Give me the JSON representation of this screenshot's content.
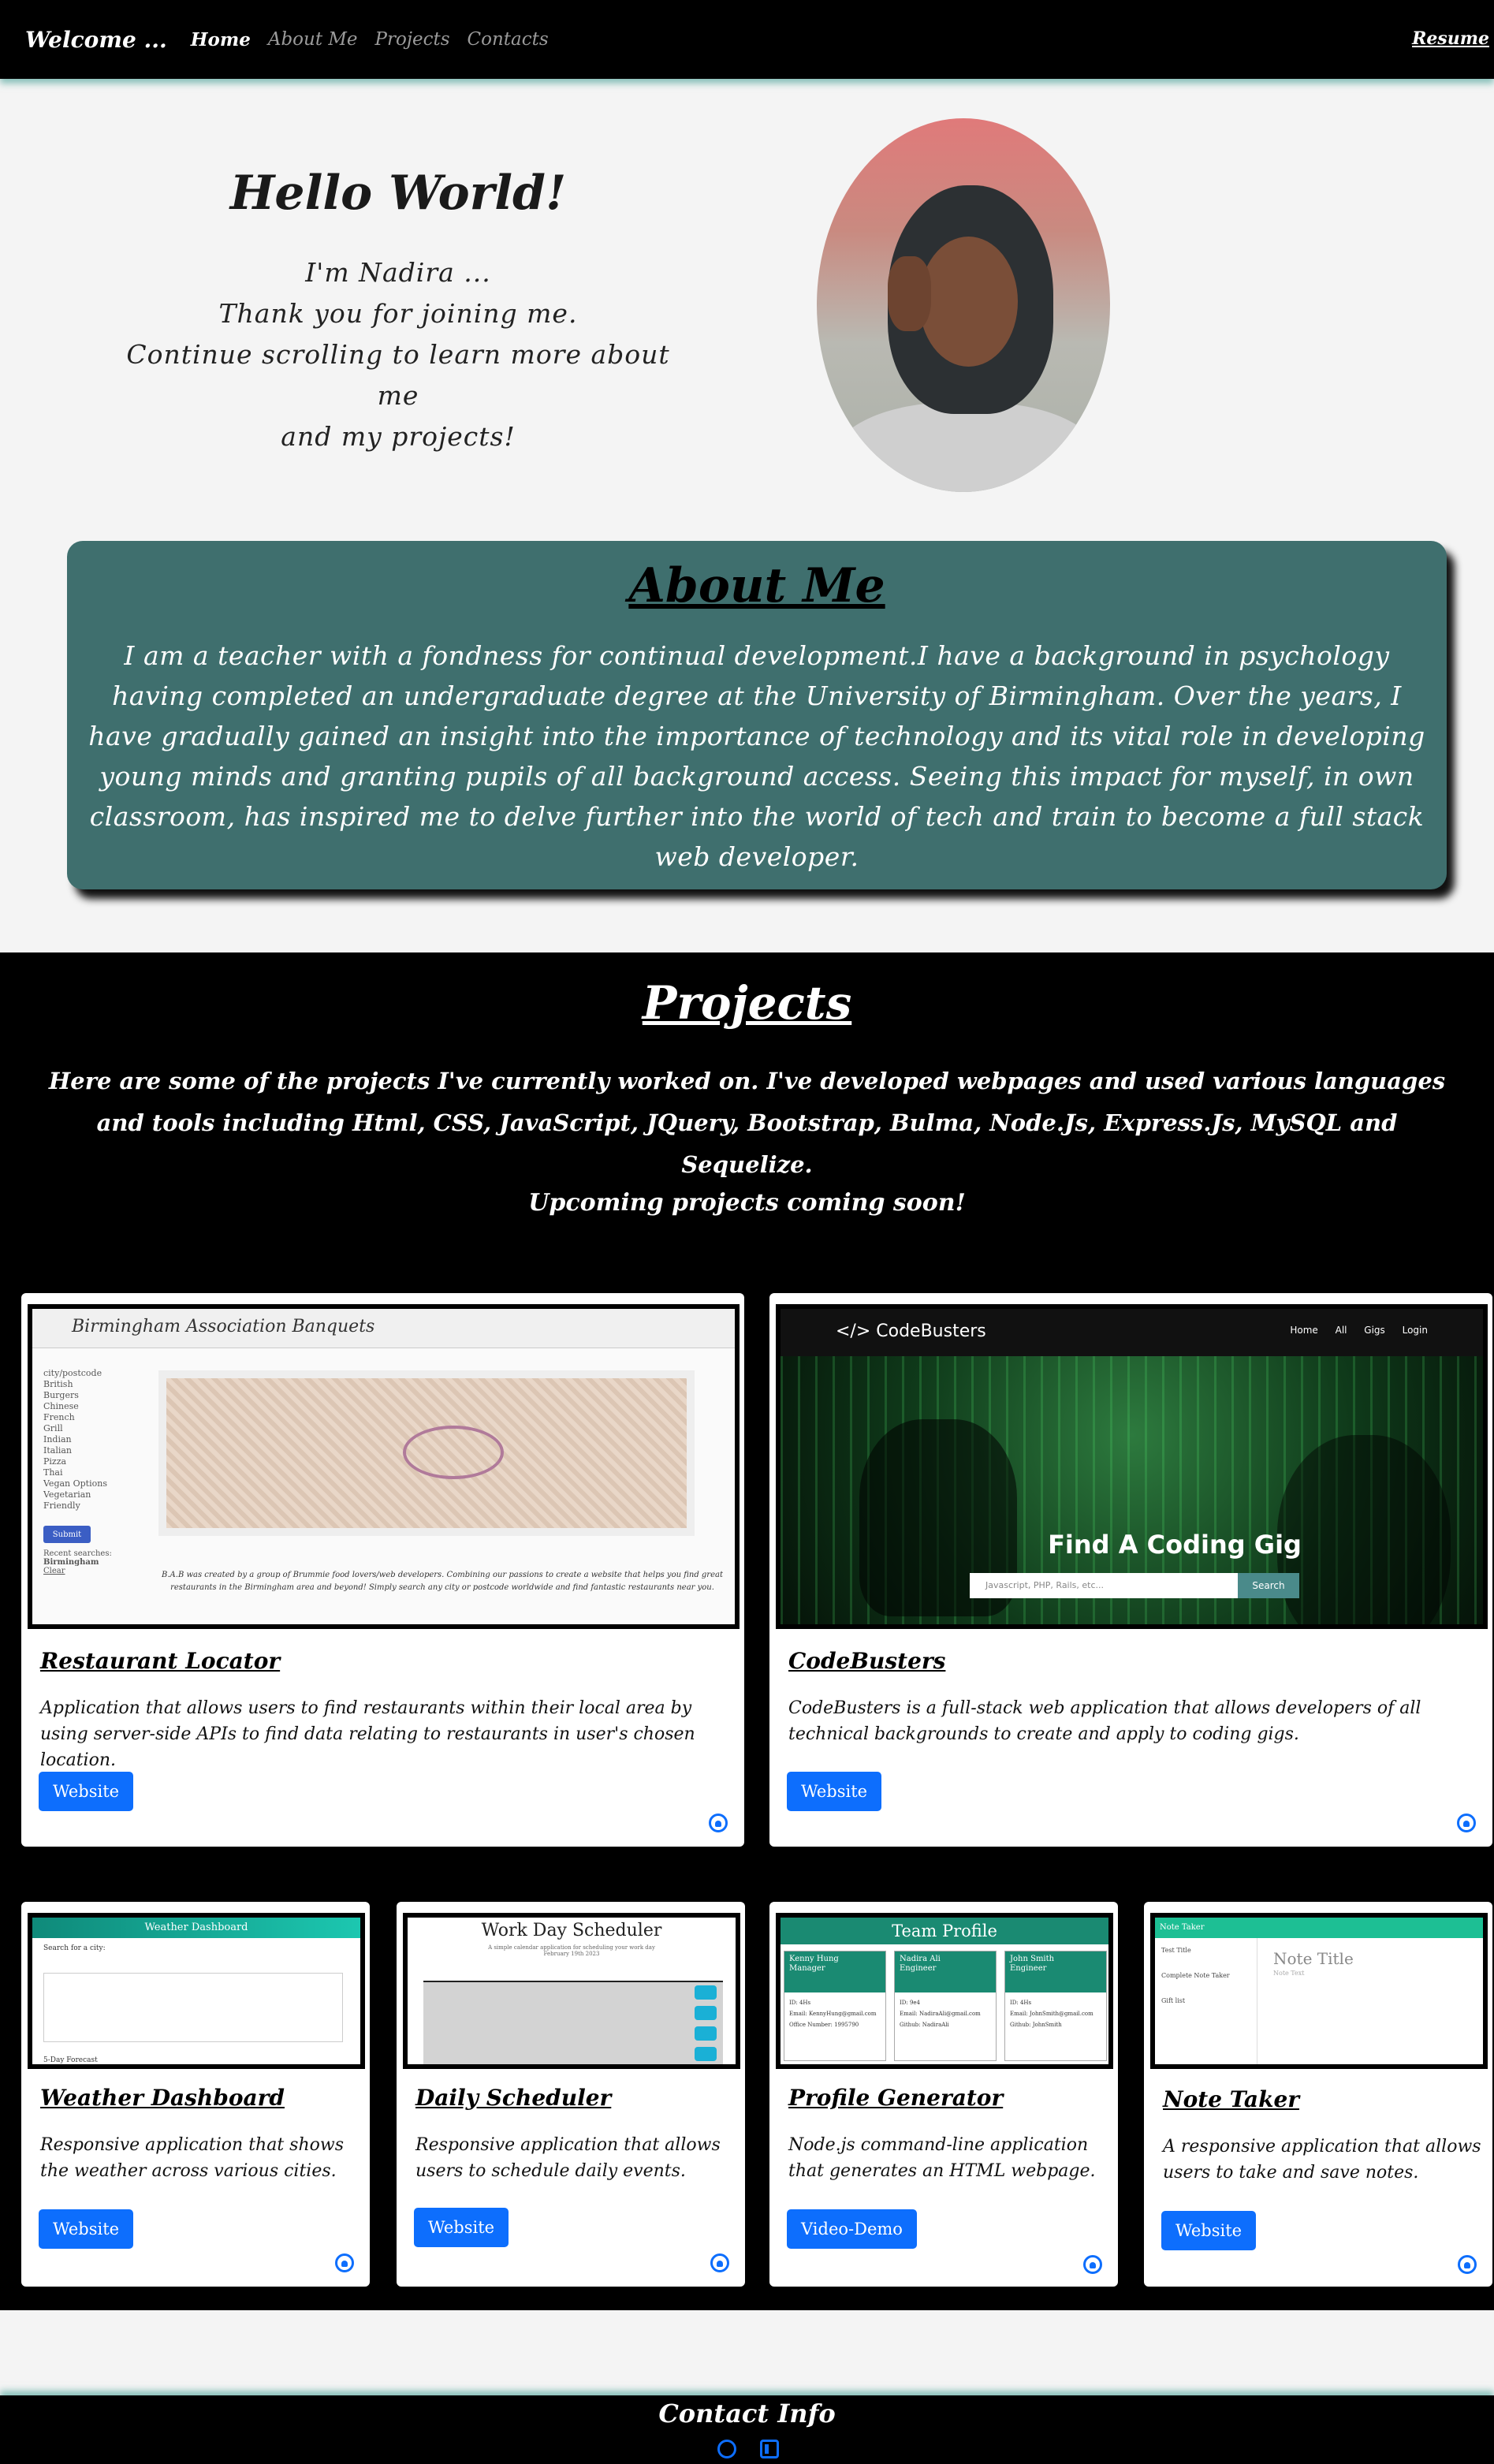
{
  "nav": {
    "brand": "Welcome ...",
    "links": [
      {
        "label": "Home",
        "active": true
      },
      {
        "label": "About Me",
        "active": false
      },
      {
        "label": "Projects",
        "active": false
      },
      {
        "label": "Contacts",
        "active": false
      }
    ],
    "resume": "Resume"
  },
  "hero": {
    "title": "Hello World!",
    "lines": [
      "I'm Nadira ...",
      "Thank you for joining me.",
      "Continue scrolling to learn more about me",
      "and my projects!"
    ]
  },
  "about": {
    "title": "About Me",
    "text": "I am a teacher with a fondness for continual development.I have a background in psychology having completed an undergraduate degree at the University of Birmingham. Over the years, I have gradually gained an insight into the importance of technology and its vital role in developing young minds and granting pupils of all background access. Seeing this impact for myself, in own classroom, has inspired me to delve further into the world of tech and train to become a full stack web developer."
  },
  "projects": {
    "title": "Projects",
    "intro": "Here are some of the projects I've currently worked on. I've developed webpages and used various languages and tools including Html, CSS, JavaScript, JQuery, Bootstrap, Bulma, Node.Js, Express.Js, MySQL and Sequelize.",
    "soon": "Upcoming projects coming soon!",
    "cards": [
      {
        "title": "Restaurant Locator",
        "desc": "Application that allows users to find restaurants within their local area by using server-side APIs to find data relating to restaurants in user's chosen location.",
        "button": "Website",
        "shot": {
          "header": "Birmingham Association Banquets",
          "side": [
            "city/postcode",
            "British",
            "Burgers",
            "Chinese",
            "French",
            "Grill",
            "Indian",
            "Italian",
            "Pizza",
            "Thai",
            "Vegan Options",
            "Vegetarian Friendly"
          ],
          "submit": "Submit",
          "recent": "Recent searches:",
          "recent_city": "Birmingham",
          "clear": "Clear",
          "note": "B.A.B was created by a group of Brummie food lovers/web developers. Combining our passions to create a website that helps you find great restaurants in the Birmingham area and beyond! Simply search any city or postcode worldwide and find fantastic restaurants near you."
        }
      },
      {
        "title": "CodeBusters",
        "desc": "CodeBusters is a full-stack web application that allows developers of all technical backgrounds to create and apply to coding gigs.",
        "button": "Website",
        "shot": {
          "logo": "</> CodeBusters",
          "links": "Home All Gigs Login",
          "headline": "Find A Coding Gig",
          "search_placeholder": "Javascript, PHP, Rails, etc...",
          "search_button": "Search"
        }
      },
      {
        "title": "Weather Dashboard",
        "desc": "Responsive application that shows the weather across various cities.",
        "button": "Website",
        "shot": {
          "bar": "Weather Dashboard",
          "label": "Search for a city:",
          "forecast": "5-Day Forecast"
        }
      },
      {
        "title": "Daily Scheduler",
        "desc": "Responsive application that allows users to schedule daily events.",
        "button": "Website",
        "shot": {
          "title": "Work Day Scheduler",
          "sub": "A simple calendar application for scheduling your work day",
          "date": "February 19th 2023"
        }
      },
      {
        "title": "Profile Generator",
        "desc": "Node.js command-line application that generates an HTML webpage.",
        "button": "Video-Demo",
        "shot": {
          "bar": "Team Profile",
          "people": [
            {
              "name": "Kenny Hung",
              "role": "Manager",
              "id": "ID: 4Hs",
              "email": "Email: KennyHung@gmail.com",
              "extra": "Office Number: 1995790"
            },
            {
              "name": "Nadira Ali",
              "role": "Engineer",
              "id": "ID: 9e4",
              "email": "Email: NadiraAli@gmail.com",
              "extra": "Github: NadiraAli"
            },
            {
              "name": "John Smith",
              "role": "Engineer",
              "id": "ID: 4Hs",
              "email": "Email: JohnSmith@gmail.com",
              "extra": "Github: JohnSmith"
            }
          ]
        }
      },
      {
        "title": "Note Taker",
        "desc": "A responsive application that allows users to take and save notes.",
        "button": "Website",
        "shot": {
          "bar": "Note Taker",
          "items": [
            "Test Title",
            "Complete Note Taker",
            "Gift list"
          ],
          "note_title": "Note Title",
          "note_text": "Note Text"
        }
      }
    ]
  },
  "footer": {
    "title": "Contact Info"
  },
  "colors": {
    "accent": "#0d6efd",
    "about_bg": "#3f6f6e",
    "nav_bg": "#000000",
    "page_bg": "#f4f4f4"
  }
}
